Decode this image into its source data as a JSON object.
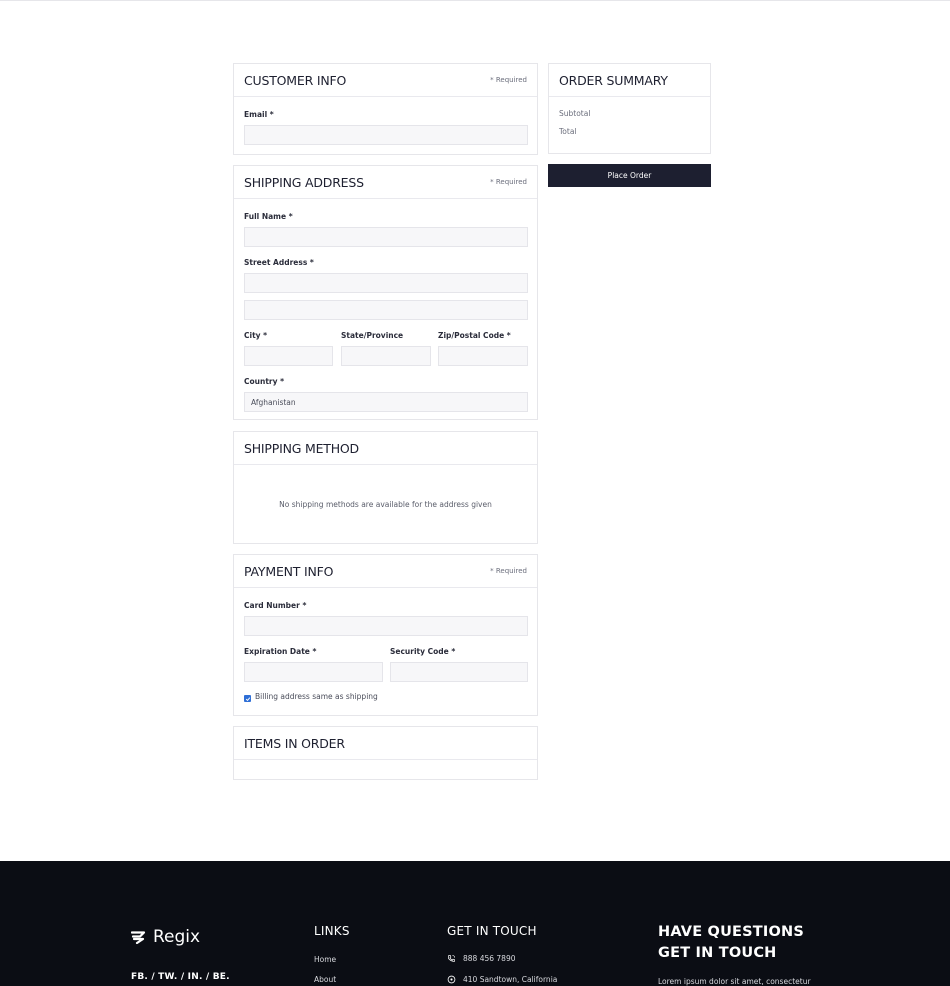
{
  "customer_info": {
    "title": "CUSTOMER INFO",
    "required_note": "* Required",
    "email_label": "Email *",
    "email_value": ""
  },
  "shipping_address": {
    "title": "SHIPPING ADDRESS",
    "required_note": "* Required",
    "full_name_label": "Full Name *",
    "street_label": "Street Address *",
    "city_label": "City *",
    "state_label": "State/Province",
    "zip_label": "Zip/Postal Code *",
    "country_label": "Country *",
    "country_value": "Afghanistan"
  },
  "shipping_method": {
    "title": "SHIPPING METHOD",
    "message": "No shipping methods are available for the address given"
  },
  "payment_info": {
    "title": "PAYMENT INFO",
    "required_note": "* Required",
    "card_label": "Card Number *",
    "expiry_label": "Expiration Date *",
    "security_label": "Security Code *",
    "billing_same_label": "Billing address same as shipping",
    "billing_same_checked": true
  },
  "items_in_order": {
    "title": "ITEMS IN ORDER"
  },
  "order_summary": {
    "title": "ORDER SUMMARY",
    "subtotal_label": "Subtotal",
    "total_label": "Total",
    "place_order_label": "Place Order"
  },
  "footer": {
    "brand": "Regix",
    "social": "FB. / TW. / IN. / BE.",
    "links_title": "LINKS",
    "links": [
      "Home",
      "About"
    ],
    "contact_title": "GET IN TOUCH",
    "phone": "888 456 7890",
    "address": "410 Sandtown, California",
    "questions_title_line1": "HAVE QUESTIONS",
    "questions_title_line2": "GET IN TOUCH",
    "questions_text": "Lorem ipsum dolor sit amet, consectetur"
  },
  "colors": {
    "accent_dark": "#1d1f30",
    "footer_bg": "#0b0d14",
    "checkbox": "#2f6fd6"
  }
}
